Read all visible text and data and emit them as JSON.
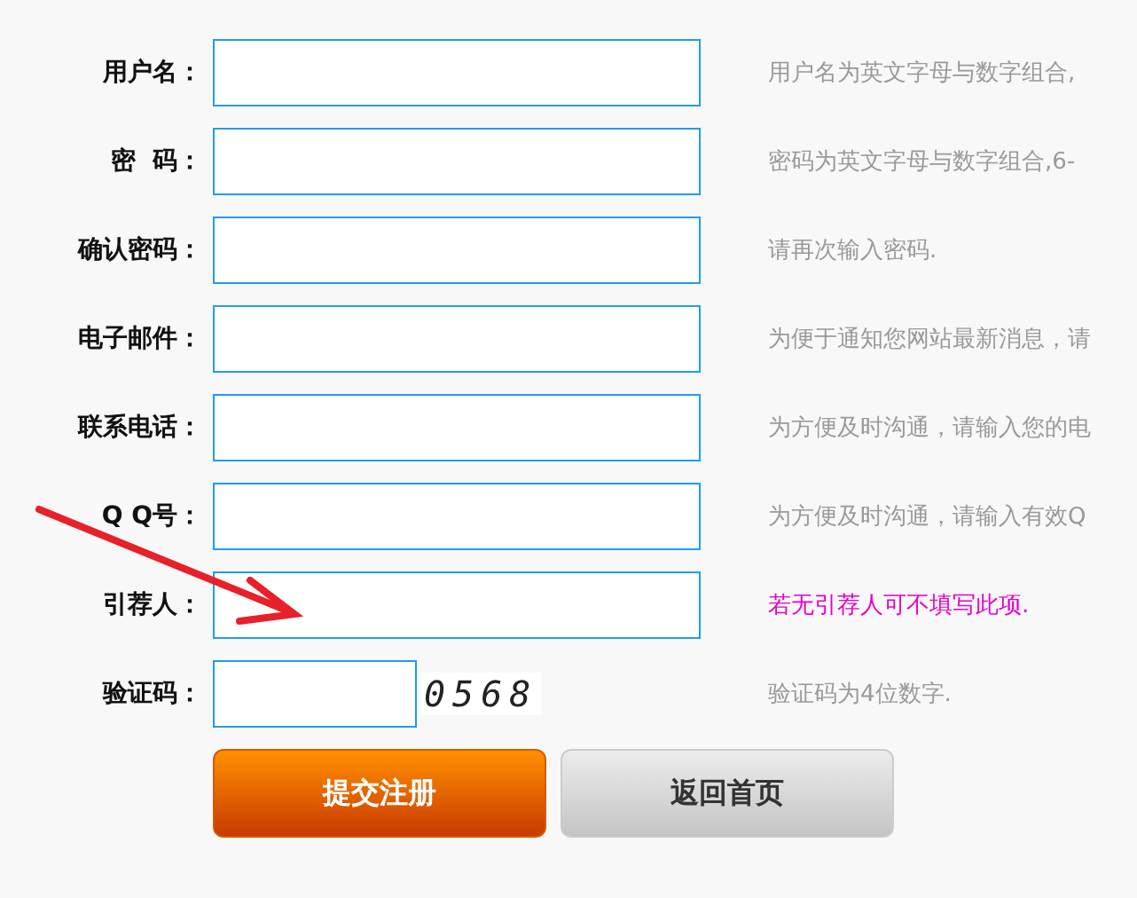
{
  "fields": [
    {
      "label": "用户名：",
      "kind": "text",
      "hint": "用户名为英文字母与数字组合,",
      "emphasized": false
    },
    {
      "label": "密  码：",
      "kind": "text",
      "hint": "密码为英文字母与数字组合,6-",
      "emphasized": false
    },
    {
      "label": "确认密码：",
      "kind": "text",
      "hint": "请再次输入密码.",
      "emphasized": false
    },
    {
      "label": "电子邮件：",
      "kind": "text",
      "hint": "为便于通知您网站最新消息，请",
      "emphasized": false
    },
    {
      "label": "联系电话：",
      "kind": "text",
      "hint": "为方便及时沟通，请输入您的电",
      "emphasized": false
    },
    {
      "label": "Q Q号：",
      "kind": "text",
      "hint": "为方便及时沟通，请输入有效Q",
      "emphasized": false
    },
    {
      "label": "引荐人：",
      "kind": "text",
      "hint": "若无引荐人可不填写此项.",
      "emphasized": true
    },
    {
      "label": "验证码：",
      "kind": "captcha",
      "captcha": "0568",
      "hint": "验证码为4位数字.",
      "emphasized": false
    }
  ],
  "buttons": [
    {
      "label": "提交注册",
      "kind": "primary"
    },
    {
      "label": "返回首页",
      "kind": "secondary"
    }
  ]
}
